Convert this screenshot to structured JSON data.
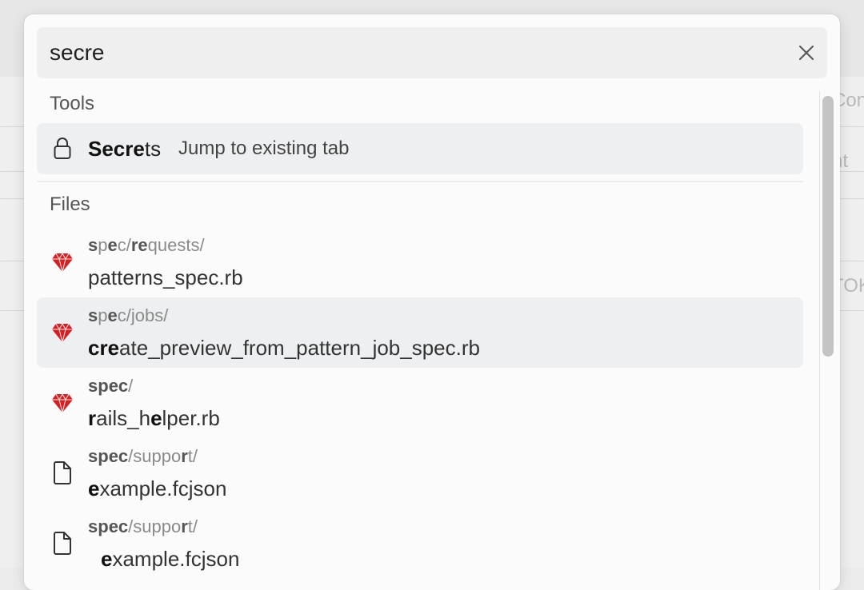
{
  "background": {
    "fragments": [
      "Con",
      "nt",
      "TOK"
    ]
  },
  "search": {
    "value": "secre",
    "placeholder": ""
  },
  "sections": {
    "tools_label": "Tools",
    "files_label": "Files"
  },
  "tools": [
    {
      "icon": "lock-icon",
      "name_match": "Secre",
      "name_rest": "ts",
      "hint": "Jump to existing tab"
    }
  ],
  "files": [
    {
      "icon": "ruby-icon",
      "path": [
        "s",
        "p",
        "e",
        "c/",
        "re",
        "quests/"
      ],
      "name": [
        "",
        "patterns_spec.rb"
      ]
    },
    {
      "icon": "ruby-icon",
      "path": [
        "s",
        "p",
        "e",
        "c/jobs/"
      ],
      "name": [
        "cre",
        "ate_preview_from_pattern_job_spec.rb"
      ]
    },
    {
      "icon": "ruby-icon",
      "path": [
        "s",
        "pec",
        "/"
      ],
      "name": [
        "r",
        "ails_h",
        "e",
        "lper.rb"
      ]
    },
    {
      "icon": "file-icon",
      "path": [
        "s",
        "pec",
        "/suppo",
        "r",
        "t/"
      ],
      "name": [
        "e",
        "xample.fcjson"
      ]
    },
    {
      "icon": "file-icon",
      "path": [
        "s",
        "pec",
        "/suppo",
        "r",
        "t/"
      ],
      "name": [
        "e",
        "xample.fcjson"
      ]
    }
  ],
  "colors": {
    "ruby_red": "#d51f22",
    "selected_row": "#eeeff0"
  }
}
